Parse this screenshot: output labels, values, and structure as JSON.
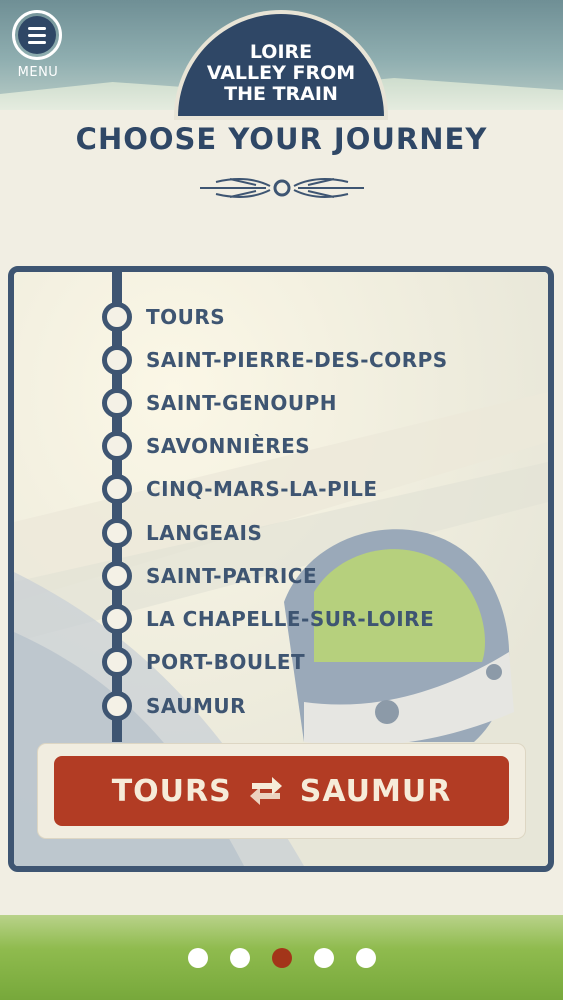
{
  "header": {
    "menu_label": "MENU",
    "title_lines": [
      "LOIRE",
      "VALLEY FROM",
      "THE TRAIN"
    ]
  },
  "page": {
    "heading": "CHOOSE YOUR JOURNEY"
  },
  "route": {
    "stops": [
      "TOURS",
      "SAINT-PIERRE-DES-CORPS",
      "SAINT-GENOUPH",
      "SAVONNIÈRES",
      "CINQ-MARS-LA-PILE",
      "LANGEAIS",
      "SAINT-PATRICE",
      "LA CHAPELLE-SUR-LOIRE",
      "PORT-BOULET",
      "SAUMUR"
    ]
  },
  "journey": {
    "from": "TOURS",
    "to": "SAUMUR",
    "icon": "swap-arrows-icon"
  },
  "pagination": {
    "count": 5,
    "active_index": 2
  },
  "colors": {
    "navy": "#2f4766",
    "accent_red": "#b23c24",
    "cream": "#f1eee3",
    "green": "#8fbb4e"
  }
}
